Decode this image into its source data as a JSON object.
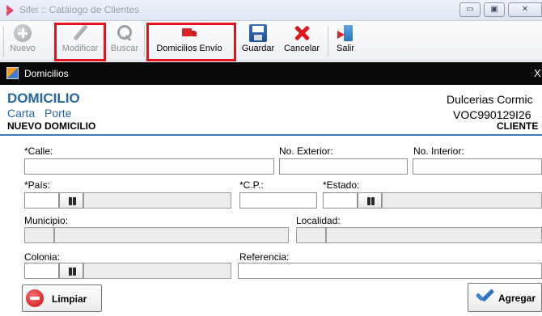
{
  "window": {
    "title": "Sifei :: Catálogo de Clientes",
    "controls": {
      "minimize": "▭",
      "maximize": "▣",
      "close": "✕"
    }
  },
  "toolbar": {
    "nuevo": "Nuevo",
    "modificar": "Modificar",
    "buscar": "Buscar",
    "domicilios_envio": "Domicilios Envío",
    "guardar": "Guardar",
    "cancelar": "Cancelar",
    "salir": "Salir"
  },
  "dialog": {
    "title": "Domicilios",
    "close": "X",
    "heading": "DOMICILIO",
    "subtitle_1": "Carta",
    "subtitle_2": "Porte",
    "mode": "NUEVO DOMICILIO",
    "client_name": "Dulcerias Cormic",
    "client_rfc": "VOC990129I26",
    "client_role": "CLIENTE"
  },
  "form": {
    "calle_label": "*Calle:",
    "no_exterior_label": "No. Exterior:",
    "no_interior_label": "No. Interior:",
    "pais_label": "*País:",
    "cp_label": "*C.P.:",
    "estado_label": "*Estado:",
    "municipio_label": "Municipio:",
    "localidad_label": "Localidad:",
    "colonia_label": "Colonia:",
    "referencia_label": "Referencia:"
  },
  "buttons": {
    "limpiar": "Limpiar",
    "agregar": "Agregar"
  },
  "colors": {
    "heading_blue": "#2766a8",
    "highlight_red": "#e4131d",
    "dialog_bar": "#0a0a0a"
  }
}
